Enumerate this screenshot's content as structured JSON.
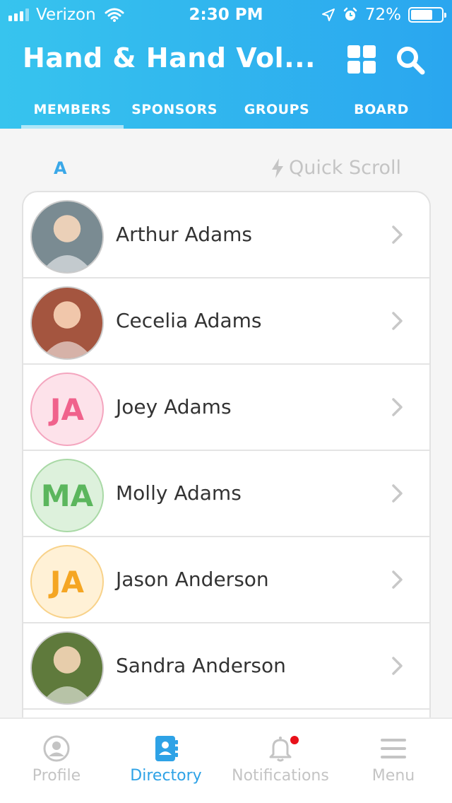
{
  "status_bar": {
    "carrier": "Verizon",
    "time": "2:30 PM",
    "battery": "72%",
    "battery_level": 0.72
  },
  "header": {
    "title": "Hand & Hand Vol..."
  },
  "tabs": [
    {
      "label": "MEMBERS",
      "active": true
    },
    {
      "label": "SPONSORS",
      "active": false
    },
    {
      "label": "GROUPS",
      "active": false
    },
    {
      "label": "BOARD",
      "active": false
    }
  ],
  "section": {
    "letter": "A",
    "quick_scroll": "Quick Scroll"
  },
  "members": [
    {
      "name": "Arthur Adams",
      "avatar": "photo",
      "initials": "",
      "bg": "#7a8b92",
      "fg": "#fff",
      "border": "#cccccc"
    },
    {
      "name": "Cecelia Adams",
      "avatar": "photo",
      "initials": "",
      "bg": "#a4553f",
      "fg": "#fff",
      "border": "#cccccc"
    },
    {
      "name": "Joey Adams",
      "avatar": "initials",
      "initials": "JA",
      "bg": "#fde2ea",
      "fg": "#f0628c",
      "border": "#f4a6bf"
    },
    {
      "name": "Molly Adams",
      "avatar": "initials",
      "initials": "MA",
      "bg": "#ddf1dc",
      "fg": "#5bb65d",
      "border": "#a9d9a6"
    },
    {
      "name": "Jason Anderson",
      "avatar": "initials",
      "initials": "JA",
      "bg": "#fff1d6",
      "fg": "#f5a623",
      "border": "#f8d28a"
    },
    {
      "name": "Sandra Anderson",
      "avatar": "photo",
      "initials": "",
      "bg": "#5f7a3c",
      "fg": "#fff",
      "border": "#cccccc"
    }
  ],
  "tabbar": [
    {
      "label": "Profile",
      "icon": "profile-icon",
      "active": false
    },
    {
      "label": "Directory",
      "icon": "directory-icon",
      "active": true
    },
    {
      "label": "Notifications",
      "icon": "bell-icon",
      "active": false,
      "has_dot": true
    },
    {
      "label": "Menu",
      "icon": "menu-icon",
      "active": false
    }
  ],
  "colors": {
    "header_start": "#37c4ee",
    "header_end": "#2aa6ef",
    "accent": "#2ea2e6",
    "notification_dot": "#e8101a"
  }
}
